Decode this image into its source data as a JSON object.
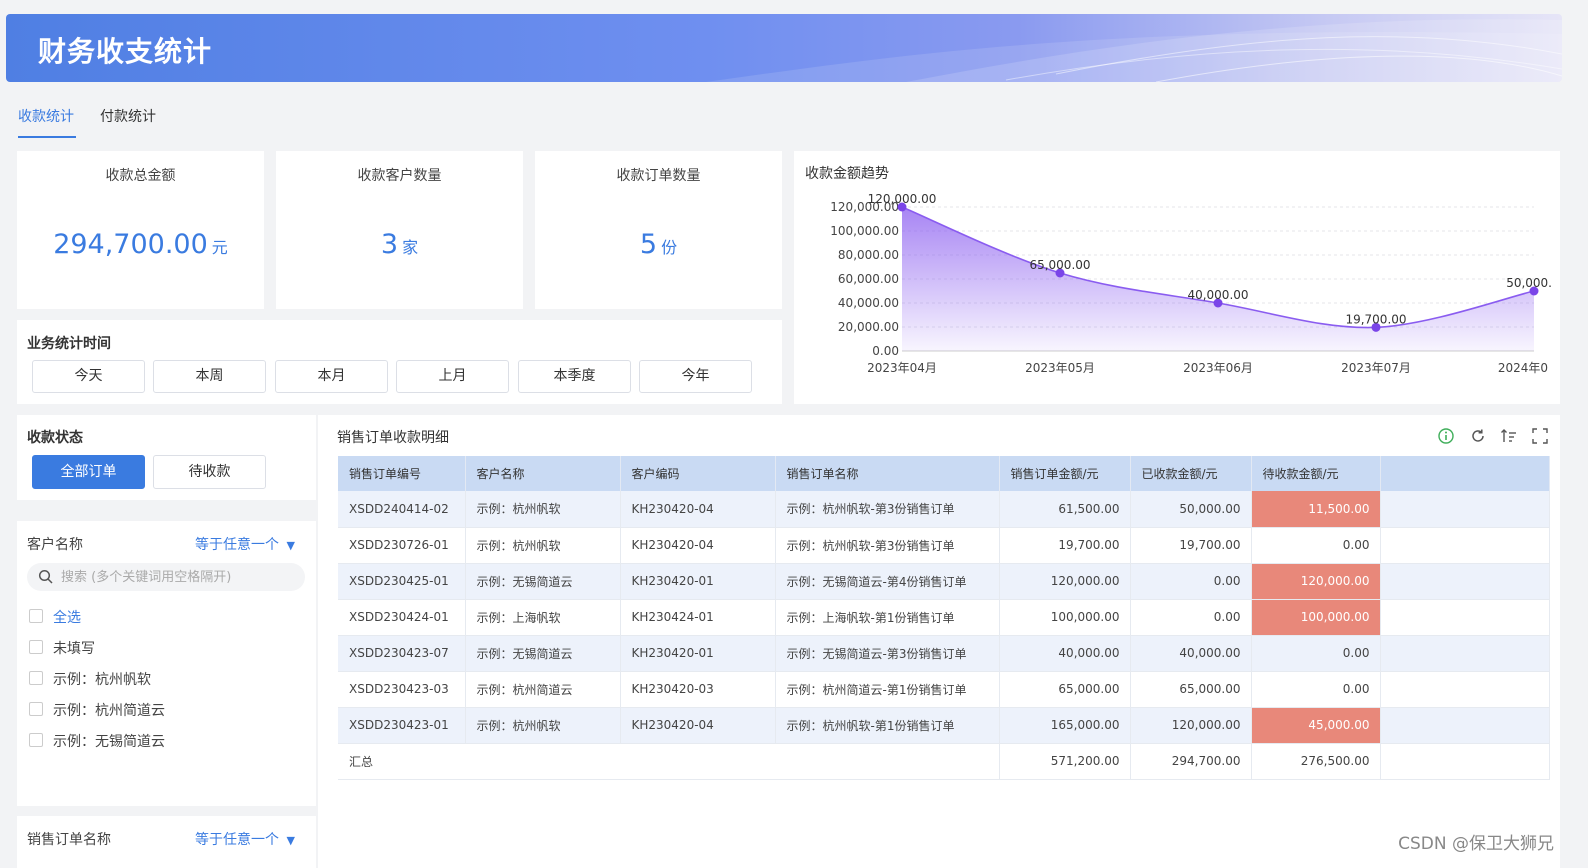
{
  "header": {
    "title": "财务收支统计"
  },
  "tabs": [
    {
      "label": "收款统计",
      "active": true
    },
    {
      "label": "付款统计",
      "active": false
    }
  ],
  "kpis": [
    {
      "title": "收款总金额",
      "value": "294,700.00",
      "unit": "元"
    },
    {
      "title": "收款客户数量",
      "value": "3",
      "unit": "家"
    },
    {
      "title": "收款订单数量",
      "value": "5",
      "unit": "份"
    }
  ],
  "business_time": {
    "title": "业务统计时间",
    "options": [
      "今天",
      "本周",
      "本月",
      "上月",
      "本季度",
      "今年"
    ]
  },
  "status": {
    "title": "收款状态",
    "options": [
      {
        "label": "全部订单",
        "active": true
      },
      {
        "label": "待收款",
        "active": false
      }
    ]
  },
  "customer_filter": {
    "label": "客户名称",
    "mode": "等于任意一个",
    "search_placeholder": "搜索 (多个关键词用空格隔开)",
    "options": [
      "全选",
      "未填写",
      "示例：杭州帆软",
      "示例：杭州简道云",
      "示例：无锡简道云"
    ]
  },
  "order_filter": {
    "label": "销售订单名称",
    "mode": "等于任意一个"
  },
  "trend_chart": {
    "title": "收款金额趋势"
  },
  "chart_data": {
    "type": "area",
    "title": "收款金额趋势",
    "categories": [
      "2023年04月",
      "2023年05月",
      "2023年06月",
      "2023年07月",
      "2024年0"
    ],
    "values": [
      120000,
      65000,
      40000,
      19700,
      50000
    ],
    "value_labels": [
      "120,000.00",
      "65,000.00",
      "40,000.00",
      "19,700.00",
      "50,000."
    ],
    "yticks": [
      "0.00",
      "20,000.00",
      "40,000.00",
      "60,000.00",
      "80,000.00",
      "100,000.00",
      "120,000.00"
    ],
    "ylim": [
      0,
      120000
    ],
    "grid": true,
    "color": "#8a5cf0"
  },
  "table": {
    "title": "销售订单收款明细",
    "columns": [
      "销售订单编号",
      "客户名称",
      "客户编码",
      "销售订单名称",
      "销售订单金额/元",
      "已收款金额/元",
      "待收款金额/元"
    ],
    "rows": [
      [
        "XSDD240414-02",
        "示例：杭州帆软",
        "KH230420-04",
        "示例：杭州帆软-第3份销售订单",
        "61,500.00",
        "50,000.00",
        "11,500.00"
      ],
      [
        "XSDD230726-01",
        "示例：杭州帆软",
        "KH230420-04",
        "示例：杭州帆软-第3份销售订单",
        "19,700.00",
        "19,700.00",
        "0.00"
      ],
      [
        "XSDD230425-01",
        "示例：无锡简道云",
        "KH230420-01",
        "示例：无锡简道云-第4份销售订单",
        "120,000.00",
        "0.00",
        "120,000.00"
      ],
      [
        "XSDD230424-01",
        "示例：上海帆软",
        "KH230424-01",
        "示例：上海帆软-第1份销售订单",
        "100,000.00",
        "0.00",
        "100,000.00"
      ],
      [
        "XSDD230423-07",
        "示例：无锡简道云",
        "KH230420-01",
        "示例：无锡简道云-第3份销售订单",
        "40,000.00",
        "40,000.00",
        "0.00"
      ],
      [
        "XSDD230423-03",
        "示例：杭州简道云",
        "KH230420-03",
        "示例：杭州简道云-第1份销售订单",
        "65,000.00",
        "65,000.00",
        "0.00"
      ],
      [
        "XSDD230423-01",
        "示例：杭州帆软",
        "KH230420-04",
        "示例：杭州帆软-第1份销售订单",
        "165,000.00",
        "120,000.00",
        "45,000.00"
      ]
    ],
    "summary": {
      "label": "汇总",
      "total": "571,200.00",
      "received": "294,700.00",
      "pending": "276,500.00"
    },
    "highlight_color": "#e8887a"
  },
  "toolbar_icons": [
    "info-icon",
    "refresh-icon",
    "sort-icon",
    "fullscreen-icon"
  ],
  "watermark": "CSDN @保卫大狮兄"
}
